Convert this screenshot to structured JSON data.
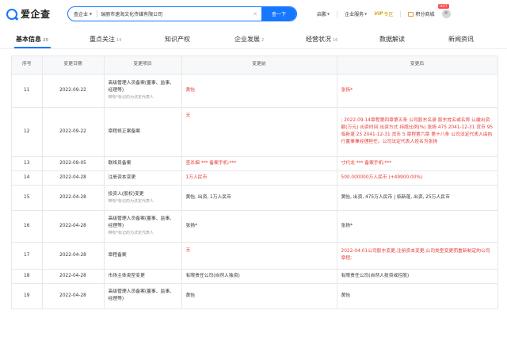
{
  "header": {
    "logo_text": "爱企查",
    "search_scope": "查企业",
    "search_value": "瑞丽市速海文化传媒有限公司",
    "clear_symbol": "✕",
    "search_button": "查一下",
    "nav": [
      {
        "label": "启鹏"
      },
      {
        "label": "企业服务"
      },
      {
        "label": "VIP",
        "sub": "专区"
      },
      {
        "label": "积分商城"
      }
    ],
    "hot_badge": "HOT"
  },
  "tabs": [
    {
      "label": "基本信息",
      "count": "20"
    },
    {
      "label": "重点关注",
      "count": "14"
    },
    {
      "label": "知识产权",
      "count": ""
    },
    {
      "label": "企业发展",
      "count": "2"
    },
    {
      "label": "经营状况",
      "count": "16"
    },
    {
      "label": "数据解读",
      "count": ""
    },
    {
      "label": "新闻资讯",
      "count": ""
    }
  ],
  "table": {
    "headers": [
      "序号",
      "变更日期",
      "变更项目",
      "变更前",
      "变更后"
    ],
    "rows": [
      {
        "no": "11",
        "date": "2022-09-22",
        "item": "高级管理人员备案(董事、监事、经理等)",
        "item_sub": "带有*标记的为法定代表人",
        "before": "黄怡",
        "after": "张扬*"
      },
      {
        "no": "12",
        "date": "2022-09-22",
        "item": "章程修正案备案",
        "item_sub": "",
        "before": "无",
        "after": "; 2022-09-14章程第四章第五条 公司股东名录 股东姓名或名称 认缴出资额(万元) 出资时间 出资方式 持股比例(%) 张扬 475 2041-12-31 货币 95 临新蓬 25 2041-12-31 货币 5 章程第六章 第十八条 公司法定代表人由执行董事兼经理担任。公司法定代表人姓名为张扬"
      },
      {
        "no": "13",
        "date": "2022-09-05",
        "item": "联络员备案",
        "item_sub": "",
        "before": "查杀烟 *** 备案手机:***",
        "after": "寸代龙 *** 备案手机:***"
      },
      {
        "no": "14",
        "date": "2022-04-28",
        "item": "注册资本变更",
        "item_sub": "",
        "before": "1万人民币",
        "after": "500.000000万人民币 (+49900.00%)"
      },
      {
        "no": "15",
        "date": "2022-04-28",
        "item": "投资人(股权)变更",
        "item_sub": "带有*标记的为法定代表人",
        "before": "黄怡, 出资, 1万人民币",
        "after": "黄怡, 出资, 475万人民币 | 临新蓬, 出资, 25万人民币"
      },
      {
        "no": "16",
        "date": "2022-04-28",
        "item": "高级管理人员备案(董事、监事、经理等)",
        "item_sub": "带有*标记的为法定代表人",
        "before": "张扬*",
        "after": "张扬*"
      },
      {
        "no": "17",
        "date": "2022-04-28",
        "item": "章程备案",
        "item_sub": "",
        "before": "无",
        "after": "2022-04-01公司股东变更,注册资本变更,公司类型变更而重新制定的公司章程;"
      },
      {
        "no": "18",
        "date": "2022-04-28",
        "item": "市场主体类型变更",
        "item_sub": "",
        "before": "有限责任公司(自然人独资)",
        "after": "有限责任公司(自然人投资或控股)"
      },
      {
        "no": "19",
        "date": "2022-04-28",
        "item": "高级管理人员备案(董事、监事、经理等)",
        "item_sub": "",
        "before": "黄怡",
        "after": "黄怡"
      }
    ]
  },
  "colors": {
    "accent": "#1677ff",
    "highlight_red": "#e53935",
    "vip_gold": "#d4a017",
    "header_bg": "#f7f8fa"
  }
}
